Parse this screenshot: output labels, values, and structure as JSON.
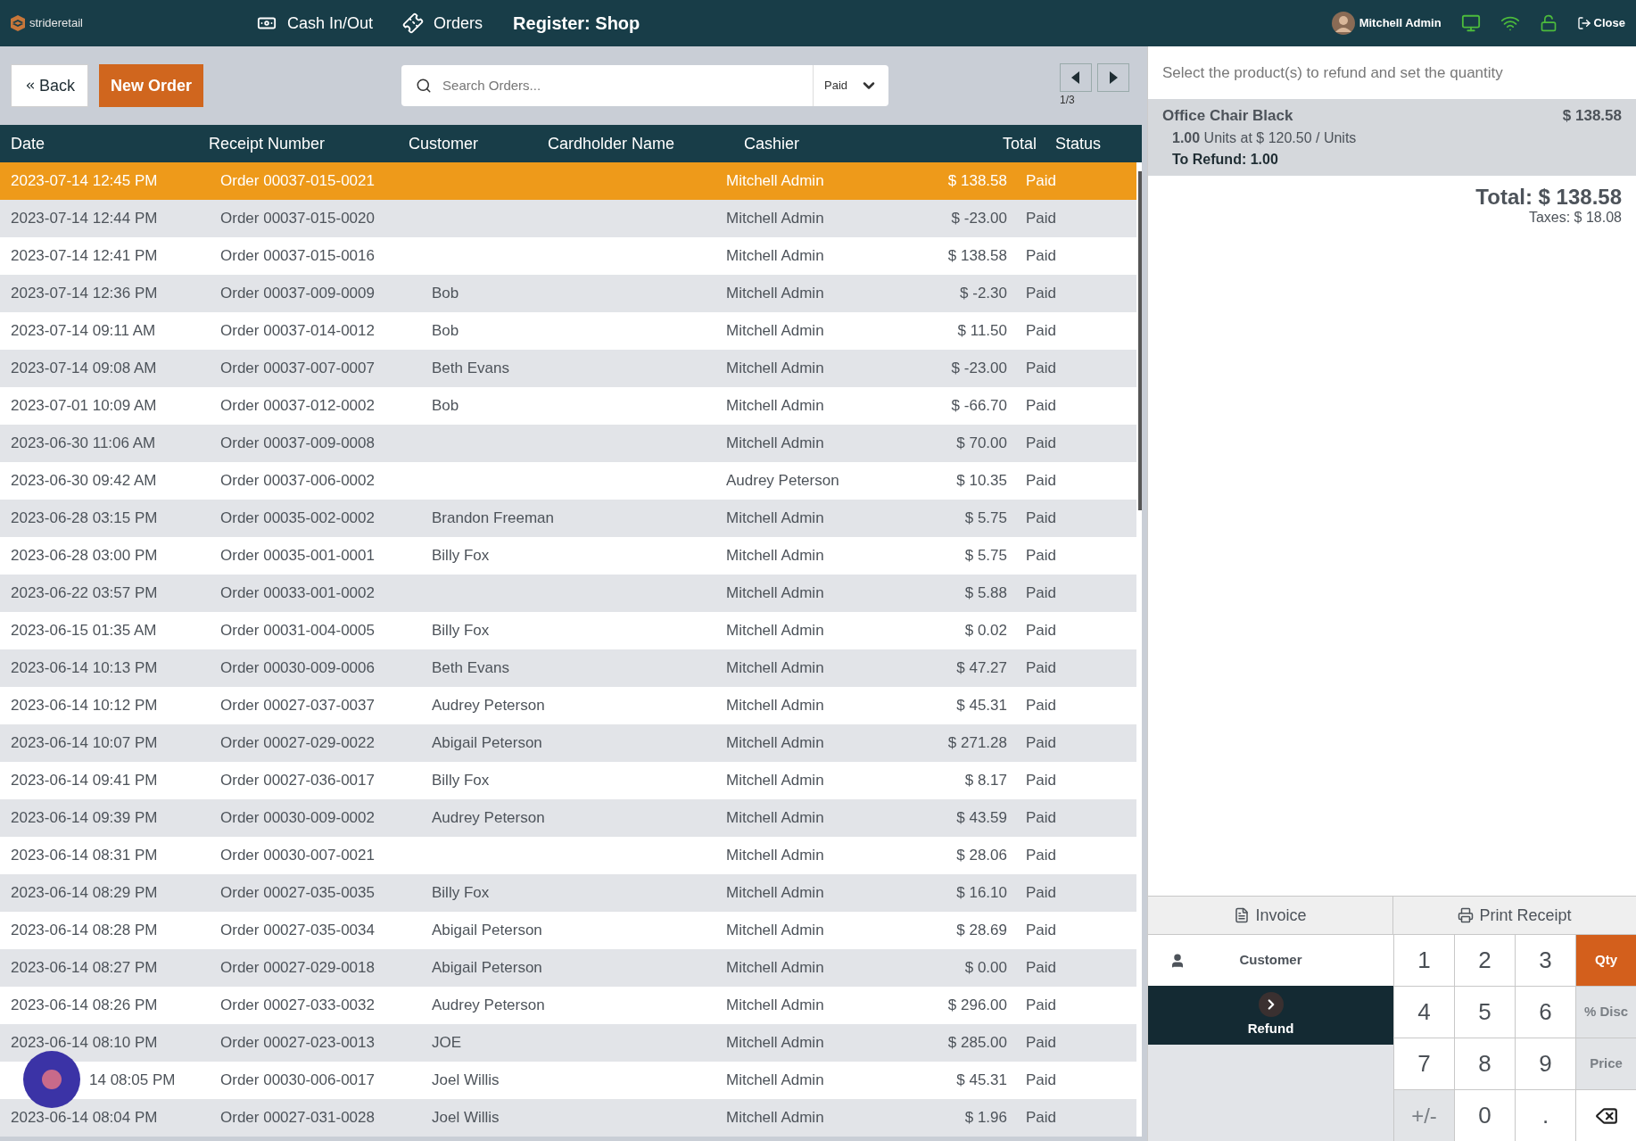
{
  "topbar": {
    "logo": "strideretail",
    "nav": [
      {
        "kind": "cash",
        "label": "Cash In/Out"
      },
      {
        "kind": "orders",
        "label": "Orders"
      }
    ],
    "register": "Register: Shop",
    "user": "Mitchell Admin",
    "close": "Close"
  },
  "toolbar": {
    "back": "Back",
    "new_order": "New Order",
    "search": {
      "placeholder": "Search Orders..."
    },
    "filter": "Paid",
    "page": "1/3"
  },
  "table": {
    "columns": [
      "Date",
      "Receipt Number",
      "Customer",
      "Cardholder Name",
      "Cashier",
      "Total",
      "Status"
    ],
    "rows": [
      {
        "selected": true,
        "cells": [
          "2023-07-14 12:45 PM",
          "Order 00037-015-0021",
          "",
          "",
          "Mitchell Admin",
          "$ 138.58",
          "Paid"
        ]
      },
      {
        "selected": false,
        "cells": [
          "2023-07-14 12:44 PM",
          "Order 00037-015-0020",
          "",
          "",
          "Mitchell Admin",
          "$ -23.00",
          "Paid"
        ]
      },
      {
        "selected": false,
        "cells": [
          "2023-07-14 12:41 PM",
          "Order 00037-015-0016",
          "",
          "",
          "Mitchell Admin",
          "$ 138.58",
          "Paid"
        ]
      },
      {
        "selected": false,
        "cells": [
          "2023-07-14 12:36 PM",
          "Order 00037-009-0009",
          "Bob",
          "",
          "Mitchell Admin",
          "$ -2.30",
          "Paid"
        ]
      },
      {
        "selected": false,
        "cells": [
          "2023-07-14 09:11 AM",
          "Order 00037-014-0012",
          "Bob",
          "",
          "Mitchell Admin",
          "$ 11.50",
          "Paid"
        ]
      },
      {
        "selected": false,
        "cells": [
          "2023-07-14 09:08 AM",
          "Order 00037-007-0007",
          "Beth Evans",
          "",
          "Mitchell Admin",
          "$ -23.00",
          "Paid"
        ]
      },
      {
        "selected": false,
        "cells": [
          "2023-07-01 10:09 AM",
          "Order 00037-012-0002",
          "Bob",
          "",
          "Mitchell Admin",
          "$ -66.70",
          "Paid"
        ]
      },
      {
        "selected": false,
        "cells": [
          "2023-06-30 11:06 AM",
          "Order 00037-009-0008",
          "",
          "",
          "Mitchell Admin",
          "$ 70.00",
          "Paid"
        ]
      },
      {
        "selected": false,
        "cells": [
          "2023-06-30 09:42 AM",
          "Order 00037-006-0002",
          "",
          "",
          "Audrey Peterson",
          "$ 10.35",
          "Paid"
        ]
      },
      {
        "selected": false,
        "cells": [
          "2023-06-28 03:15 PM",
          "Order 00035-002-0002",
          "Brandon Freeman",
          "",
          "Mitchell Admin",
          "$ 5.75",
          "Paid"
        ]
      },
      {
        "selected": false,
        "cells": [
          "2023-06-28 03:00 PM",
          "Order 00035-001-0001",
          "Billy Fox",
          "",
          "Mitchell Admin",
          "$ 5.75",
          "Paid"
        ]
      },
      {
        "selected": false,
        "cells": [
          "2023-06-22 03:57 PM",
          "Order 00033-001-0002",
          "",
          "",
          "Mitchell Admin",
          "$ 5.88",
          "Paid"
        ]
      },
      {
        "selected": false,
        "cells": [
          "2023-06-15 01:35 AM",
          "Order 00031-004-0005",
          "Billy Fox",
          "",
          "Mitchell Admin",
          "$ 0.02",
          "Paid"
        ]
      },
      {
        "selected": false,
        "cells": [
          "2023-06-14 10:13 PM",
          "Order 00030-009-0006",
          "Beth Evans",
          "",
          "Mitchell Admin",
          "$ 47.27",
          "Paid"
        ]
      },
      {
        "selected": false,
        "cells": [
          "2023-06-14 10:12 PM",
          "Order 00027-037-0037",
          "Audrey Peterson",
          "",
          "Mitchell Admin",
          "$ 45.31",
          "Paid"
        ]
      },
      {
        "selected": false,
        "cells": [
          "2023-06-14 10:07 PM",
          "Order 00027-029-0022",
          "Abigail Peterson",
          "",
          "Mitchell Admin",
          "$ 271.28",
          "Paid"
        ]
      },
      {
        "selected": false,
        "cells": [
          "2023-06-14 09:41 PM",
          "Order 00027-036-0017",
          "Billy Fox",
          "",
          "Mitchell Admin",
          "$ 8.17",
          "Paid"
        ]
      },
      {
        "selected": false,
        "cells": [
          "2023-06-14 09:39 PM",
          "Order 00030-009-0002",
          "Audrey Peterson",
          "",
          "Mitchell Admin",
          "$ 43.59",
          "Paid"
        ]
      },
      {
        "selected": false,
        "cells": [
          "2023-06-14 08:31 PM",
          "Order 00030-007-0021",
          "",
          "",
          "Mitchell Admin",
          "$ 28.06",
          "Paid"
        ]
      },
      {
        "selected": false,
        "cells": [
          "2023-06-14 08:29 PM",
          "Order 00027-035-0035",
          "Billy Fox",
          "",
          "Mitchell Admin",
          "$ 16.10",
          "Paid"
        ]
      },
      {
        "selected": false,
        "cells": [
          "2023-06-14 08:28 PM",
          "Order 00027-035-0034",
          "Abigail Peterson",
          "",
          "Mitchell Admin",
          "$ 28.69",
          "Paid"
        ]
      },
      {
        "selected": false,
        "cells": [
          "2023-06-14 08:27 PM",
          "Order 00027-029-0018",
          "Abigail Peterson",
          "",
          "Mitchell Admin",
          "$ 0.00",
          "Paid"
        ]
      },
      {
        "selected": false,
        "cells": [
          "2023-06-14 08:26 PM",
          "Order 00027-033-0032",
          "Audrey Peterson",
          "",
          "Mitchell Admin",
          "$ 296.00",
          "Paid"
        ]
      },
      {
        "selected": false,
        "cells": [
          "2023-06-14 08:10 PM",
          "Order 00027-023-0013",
          "JOE",
          "",
          "Mitchell Admin",
          "$ 285.00",
          "Paid"
        ]
      },
      {
        "selected": false,
        "overlay": true,
        "cells": [
          "14 08:05 PM",
          "Order 00030-006-0017",
          "Joel Willis",
          "",
          "Mitchell Admin",
          "$ 45.31",
          "Paid"
        ]
      },
      {
        "selected": false,
        "cells": [
          "2023-06-14 08:04 PM",
          "Order 00027-031-0028",
          "Joel Willis",
          "",
          "Mitchell Admin",
          "$ 1.96",
          "Paid"
        ]
      }
    ]
  },
  "refund_panel": {
    "hint": "Select the product(s) to refund and set the quantity",
    "lines": [
      {
        "name": "Office Chair Black",
        "price": "$ 138.58",
        "qty": "1.00",
        "unit_text": "Units at $ 120.50 / Units",
        "to_refund": "To Refund: 1.00"
      }
    ],
    "total": "Total: $ 138.58",
    "taxes": "Taxes: $ 18.08"
  },
  "actions": {
    "invoice": "Invoice",
    "print": "Print Receipt",
    "customer": "Customer",
    "refund": "Refund"
  },
  "keypad": [
    {
      "label": "1",
      "kind": "digit"
    },
    {
      "label": "2",
      "kind": "digit"
    },
    {
      "label": "3",
      "kind": "digit"
    },
    {
      "label": "Qty",
      "kind": "mode",
      "selected": true
    },
    {
      "label": "4",
      "kind": "digit"
    },
    {
      "label": "5",
      "kind": "digit"
    },
    {
      "label": "6",
      "kind": "digit"
    },
    {
      "label": "% Disc",
      "kind": "mode",
      "selected": false
    },
    {
      "label": "7",
      "kind": "digit"
    },
    {
      "label": "8",
      "kind": "digit"
    },
    {
      "label": "9",
      "kind": "digit"
    },
    {
      "label": "Price",
      "kind": "mode",
      "selected": false
    },
    {
      "label": "+/-",
      "kind": "sign"
    },
    {
      "label": "0",
      "kind": "digit"
    },
    {
      "label": ".",
      "kind": "digit"
    },
    {
      "kind": "backspace"
    }
  ]
}
